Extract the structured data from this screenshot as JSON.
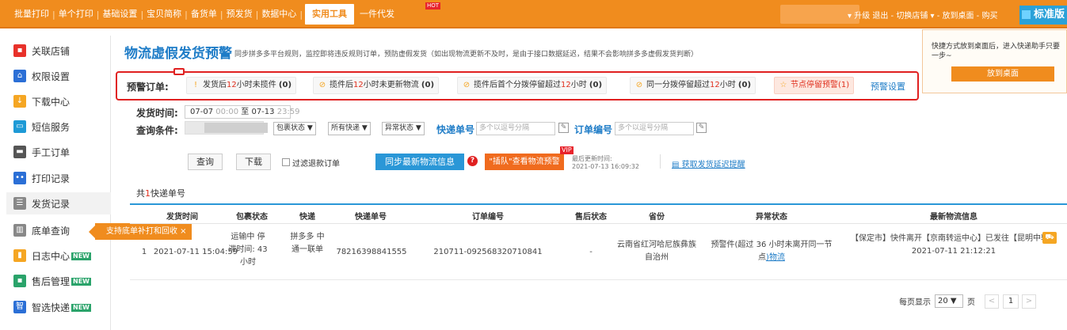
{
  "topnav": {
    "items": [
      "批量打印",
      "单个打印",
      "基础设置",
      "宝贝简称",
      "备货单",
      "预发货",
      "数据中心"
    ],
    "active": "实用工具",
    "after": "一件代发",
    "hot": "HOT",
    "right": "▾ 升级  退出 - 切换店铺 ▾ - 放到桌面 - 购买",
    "edition": "标准版"
  },
  "sidebar": {
    "items": [
      {
        "label": "关联店铺",
        "icon": "link-icon",
        "color": "#e8312a",
        "glyph": "▪"
      },
      {
        "label": "权限设置",
        "icon": "lock-icon",
        "color": "#2b6fd6",
        "glyph": "⌂"
      },
      {
        "label": "下载中心",
        "icon": "download-icon",
        "color": "#f5a623",
        "glyph": "↓"
      },
      {
        "label": "短信服务",
        "icon": "message-icon",
        "color": "#1e9ad6",
        "glyph": "▭"
      },
      {
        "label": "手工订单",
        "icon": "printer-icon",
        "color": "#555555",
        "glyph": "▬"
      },
      {
        "label": "打印记录",
        "icon": "record-icon",
        "color": "#2b6fd6",
        "glyph": "••"
      },
      {
        "label": "发货记录",
        "icon": "ship-record-icon",
        "color": "#888888",
        "glyph": "☰"
      },
      {
        "label": "底单查询",
        "icon": "search-doc-icon",
        "color": "#888888",
        "glyph": "▥"
      },
      {
        "label": "日志中心",
        "icon": "log-icon",
        "color": "#f5a623",
        "glyph": "▮",
        "new": "NEW"
      },
      {
        "label": "售后管理",
        "icon": "aftersale-icon",
        "color": "#2aa36a",
        "glyph": "▪",
        "new": "NEW"
      },
      {
        "label": "智选快递",
        "icon": "smart-express-icon",
        "color": "#2b6fd6",
        "glyph": "智",
        "new": "NEW"
      }
    ],
    "tip": "支持底单补打和回收 ×"
  },
  "page": {
    "title": "物流虚假发货预警",
    "subtitle": "同步拼多多平台规则，监控即将违反规则订单，预防虚假发货（如出现物流更新不及时，是由于接口数据延迟，结果不会影响拼多多虚假发货判断）"
  },
  "warn": {
    "label": "预警订单:",
    "chips": [
      {
        "pre": "发货后",
        "hl": "12",
        "post": "小时未揽件 ",
        "count": "(0)",
        "icon": "!"
      },
      {
        "pre": "揽件后",
        "hl": "12",
        "post": "小时未更新物流 ",
        "count": "(0)",
        "icon": "⊘"
      },
      {
        "pre": "揽件后首个分拨停留超过",
        "hl": "12",
        "post": "小时 ",
        "count": "(0)",
        "icon": "⊘"
      },
      {
        "pre": "同一分拨停留超过",
        "hl": "12",
        "post": "小时 ",
        "count": "(0)",
        "icon": "⊘"
      }
    ],
    "node_chip": "节点停留预警(1)",
    "settings": "预警设置"
  },
  "filter": {
    "ship_time_label": "发货时间:",
    "date_from": "07-07",
    "time_from": "00:00",
    "to": "至",
    "date_to": "07-13",
    "time_to": "23:59",
    "query_label": "查询条件:",
    "sel_package": "包裹状态 ▼",
    "sel_express": "所有快递 ▼",
    "sel_abnormal": "异常状态 ▼",
    "tracking_label": "快递单号",
    "tracking_placeholder": "多个以逗号分隔",
    "order_label": "订单编号",
    "order_placeholder": "多个以逗号分隔"
  },
  "actions": {
    "query": "查询",
    "download": "下载",
    "filter_refund": "过滤退款订单",
    "sync": "同步最新物流信息",
    "jump": "\"插队\"查看物流预警",
    "vip": "VIP",
    "last_update_label": "最后更新时间:",
    "last_update": "2021-07-13 16:09:32",
    "get_delay": "获取发货延迟提醒"
  },
  "table": {
    "total_pre": "共",
    "total_n": "1",
    "total_post": "快递单号",
    "headers": [
      "发货时间",
      "包裹状态",
      "快递",
      "快递单号",
      "订单编号",
      "售后状态",
      "省份",
      "异常状态",
      "最新物流信息"
    ],
    "row": {
      "index": "1",
      "ship_time": "2021-07-11 15:04:59",
      "package_status": "运输中 停滞时间: 43小时",
      "express": "拼多多 中通一联单",
      "tracking": "78216398841555",
      "order": "210711-092568320710841",
      "aftersale": "-",
      "province": "云南省红河哈尼族彝族自治州",
      "abnormal": "预警件(超过 36 小时未离开同一节点",
      "abnormal_link": ")物流",
      "logistics": "【保定市】快件离开【京南转运中心】已发往【昆明中转】",
      "logistics_time": "2021-07-11 21:12:21"
    }
  },
  "pager": {
    "per_page_label": "每页显示",
    "per_page": "20 ▼",
    "unit": "页",
    "prev": "<",
    "current": "1",
    "next": ">"
  },
  "popup": {
    "text": "快捷方式放到桌面后，进入快递助手只要一步~",
    "button": "放到桌面"
  }
}
